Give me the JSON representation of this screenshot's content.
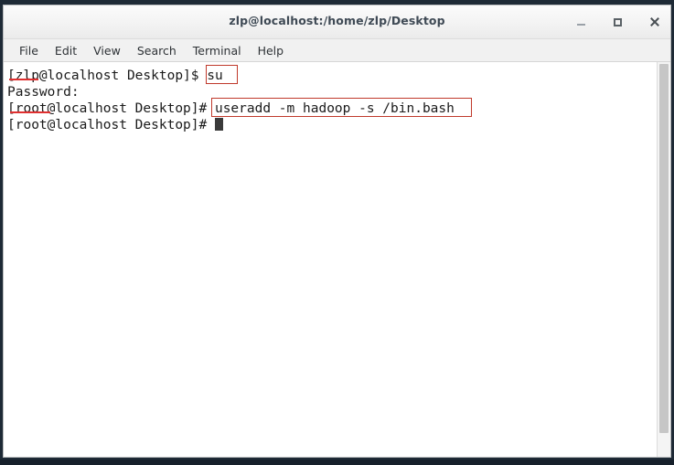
{
  "window": {
    "title": "zlp@localhost:/home/zlp/Desktop",
    "controls": {
      "minimize_label": "Minimize",
      "maximize_label": "Maximize",
      "close_label": "Close"
    }
  },
  "menubar": {
    "items": [
      {
        "label": "File"
      },
      {
        "label": "Edit"
      },
      {
        "label": "View"
      },
      {
        "label": "Search"
      },
      {
        "label": "Terminal"
      },
      {
        "label": "Help"
      }
    ]
  },
  "terminal": {
    "lines": [
      {
        "text": "[zlp@localhost Desktop]$ su"
      },
      {
        "text": "Password:"
      },
      {
        "text": "[root@localhost Desktop]# useradd -m hadoop -s /bin.bash"
      },
      {
        "text": "[root@localhost Desktop]# "
      }
    ],
    "prompt_user": "zlp",
    "prompt_root": "root",
    "command_su": "su",
    "command_useradd": "useradd -m hadoop -s /bin.bash",
    "password_prompt": "Password:",
    "cursor_visible": true
  },
  "annotations": {
    "highlight_color": "#c0392b",
    "underline_color": "#e03030",
    "boxes": [
      {
        "target": "su"
      },
      {
        "target": "useradd -m hadoop -s /bin.bash"
      }
    ],
    "underlines": [
      {
        "target": "zlp"
      },
      {
        "target": "root"
      }
    ]
  },
  "scrollbar": {
    "position": "right"
  }
}
